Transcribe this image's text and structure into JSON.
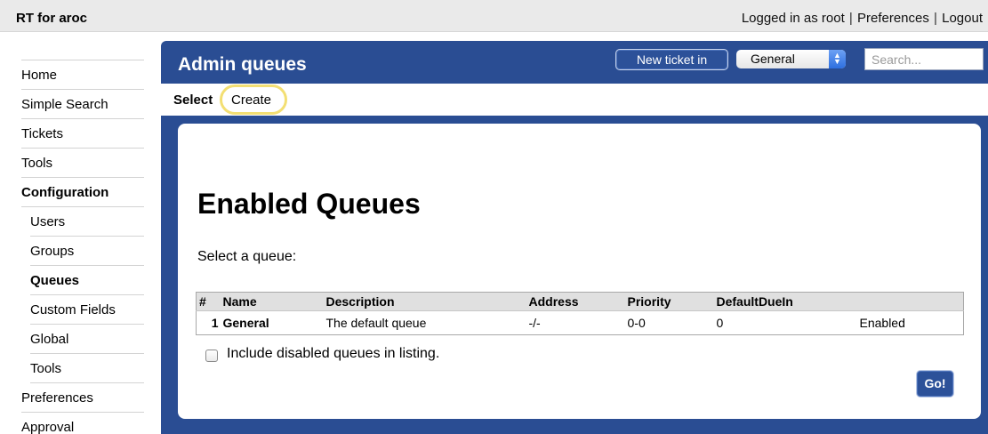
{
  "app": {
    "title": "RT for aroc"
  },
  "toplinks": {
    "logged_in": "Logged in as root",
    "preferences": "Preferences",
    "logout": "Logout",
    "separator": "|"
  },
  "nav": {
    "items": [
      {
        "label": "Home"
      },
      {
        "label": "Simple Search"
      },
      {
        "label": "Tickets"
      },
      {
        "label": "Tools"
      },
      {
        "label": "Configuration"
      },
      {
        "label": "Users"
      },
      {
        "label": "Groups"
      },
      {
        "label": "Queues"
      },
      {
        "label": "Custom Fields"
      },
      {
        "label": "Global"
      },
      {
        "label": "Tools"
      },
      {
        "label": "Preferences"
      },
      {
        "label": "Approval"
      }
    ]
  },
  "header": {
    "title": "Admin queues",
    "new_ticket_label": "New ticket in",
    "queue_select_value": "General",
    "search_placeholder": "Search..."
  },
  "tabs": {
    "select": "Select",
    "create": "Create"
  },
  "content": {
    "heading": "Enabled Queues",
    "prompt": "Select a queue:",
    "table": {
      "headers": [
        "#",
        "Name",
        "Description",
        "Address",
        "Priority",
        "DefaultDueIn",
        ""
      ],
      "rows": [
        {
          "num": "1",
          "name": "General",
          "description": "The default queue",
          "address": "-/-",
          "priority": "0-0",
          "due": "0",
          "status": "Enabled"
        }
      ]
    },
    "include_disabled_label": "Include disabled queues in listing.",
    "go_label": "Go!"
  },
  "colors": {
    "header_blue": "#2a4d93",
    "highlight_ring": "#f3df73",
    "topbar_gray": "#eaeaea"
  }
}
